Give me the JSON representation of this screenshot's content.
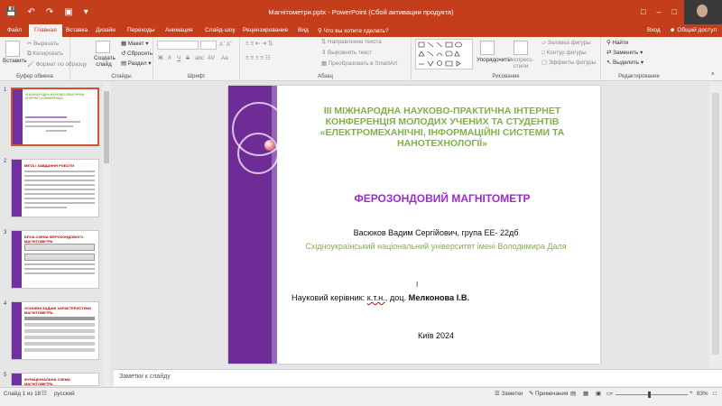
{
  "app": {
    "window_title": "Магнітометри.pptx - PowerPoint (Сбой активации продукта)",
    "sign_in": "Вход",
    "share": "Общий доступ"
  },
  "tabs": [
    "Файл",
    "Главная",
    "Вставка",
    "Дизайн",
    "Переходы",
    "Анимация",
    "Слайд-шоу",
    "Рецензирование",
    "Вид"
  ],
  "active_tab": "Главная",
  "tell_me": "Что вы хотите сделать?",
  "ribbon": {
    "clipboard": {
      "label": "Буфер обмена",
      "paste": "Вставить",
      "cut": "Вырезать",
      "copy": "Копировать",
      "format_painter": "Формат по образцу"
    },
    "slides": {
      "label": "Слайды",
      "new_slide": "Создать слайд",
      "layout": "Макет",
      "reset": "Сбросить",
      "section": "Раздел"
    },
    "font": {
      "label": "Шрифт",
      "bold": "Ж",
      "italic": "К",
      "underline": "Ч",
      "strike": "S",
      "shadow": "abc",
      "spacing": "AV",
      "case": "Aa"
    },
    "paragraph": {
      "label": "Абзац",
      "text_direction": "Направление текста",
      "align_text": "Выровнять текст",
      "convert_smartart": "Преобразовать в SmartArt"
    },
    "drawing": {
      "label": "Рисование",
      "arrange": "Упорядочить",
      "quick_styles": "Экспресс-стили",
      "shape_fill": "Заливка фигуры",
      "shape_outline": "Контур фигуры",
      "shape_effects": "Эффекты фигуры"
    },
    "editing": {
      "label": "Редактирование",
      "find": "Найти",
      "replace": "Заменить",
      "select": "Выделить"
    }
  },
  "thumbnails": [
    {
      "num": "1",
      "header": "III МІЖНАРОДНА НАУКОВО-ПРАКТИЧНА ІНТЕРНЕТ КОНФЕРЕНЦІЯ"
    },
    {
      "num": "2",
      "header": "МЕТА І ЗАВДАННЯ РОБОТИ"
    },
    {
      "num": "3",
      "header": "БЛОК-СХЕМА ФЕРОЗОНДОВОГО МАГНІТОМЕТРА"
    },
    {
      "num": "4",
      "header": "ОСНОВНІ ЗАДАНІ ХАРАКТЕРИСТИКИ МАГНІТОМЕТРА"
    },
    {
      "num": "5",
      "header": "ФУНКЦІОНАЛЬНА СХЕМА МАГНІТОМЕТРА"
    }
  ],
  "slide": {
    "conference": "III МІЖНАРОДНА НАУКОВО-ПРАКТИЧНА  ІНТЕРНЕТ КОНФЕРЕНЦІЯ МОЛОДИХ УЧЕНИХ ТА СТУДЕНТІВ «ЕЛЕКТРОМЕХАНІЧНІ, ІНФОРМАЦІЙНІ СИСТЕМИ ТА НАНОТЕХНОЛОГІЇ»",
    "title": "ФЕРОЗОНДОВИЙ МАГНІТОМЕТР",
    "author": "Васюков Вадим Сергійович,  група ЕЕ- 22дб",
    "university": "Східноукраїнський національний університет імені Володимира Даля",
    "supervisor_prefix": "Науковий керівник: ",
    "supervisor_degree": "к.т.н.",
    "supervisor_mid": ", доц. ",
    "supervisor_name": "Мелконова І.В.",
    "city_year": "Київ 2024",
    "accent_purple": "#6f2c96",
    "accent_green": "#7fb342",
    "title_color": "#9a2ecb"
  },
  "notes_placeholder": "Заметки к слайду",
  "status": {
    "slide_count": "Слайд 1 из 18",
    "language": "русский",
    "notes": "Заметки",
    "comments": "Примечания",
    "zoom": "83%"
  }
}
